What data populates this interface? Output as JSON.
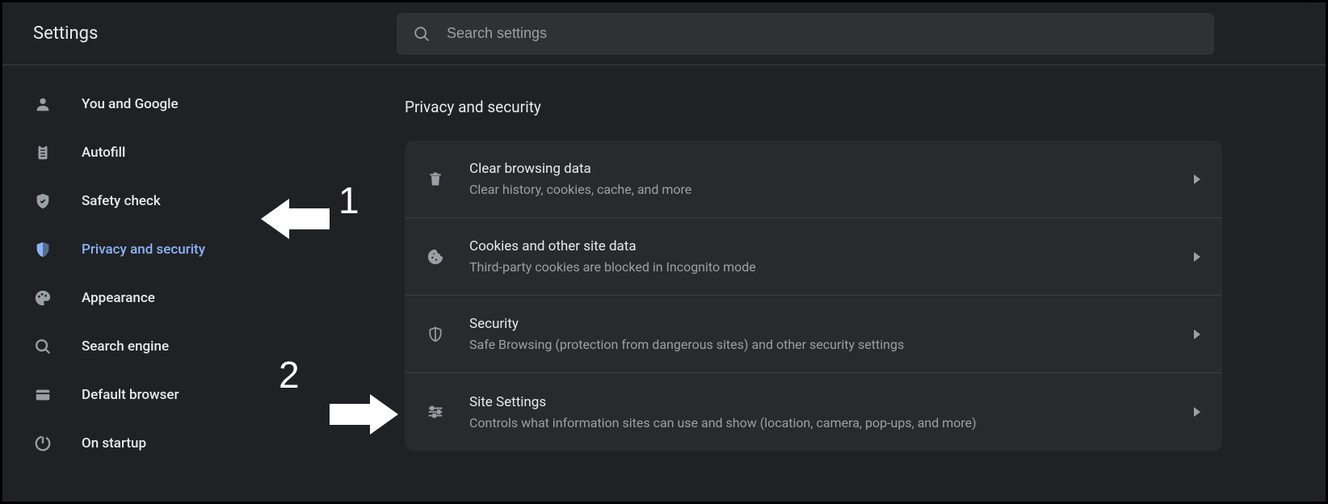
{
  "header": {
    "title": "Settings",
    "search_placeholder": "Search settings"
  },
  "sidebar": {
    "items": [
      {
        "id": "you-and-google",
        "label": "You and Google",
        "icon": "person-icon",
        "active": false
      },
      {
        "id": "autofill",
        "label": "Autofill",
        "icon": "clipboard-icon",
        "active": false
      },
      {
        "id": "safety-check",
        "label": "Safety check",
        "icon": "shield-check-icon",
        "active": false
      },
      {
        "id": "privacy-and-security",
        "label": "Privacy and security",
        "icon": "shield-icon",
        "active": true
      },
      {
        "id": "appearance",
        "label": "Appearance",
        "icon": "palette-icon",
        "active": false
      },
      {
        "id": "search-engine",
        "label": "Search engine",
        "icon": "search-icon",
        "active": false
      },
      {
        "id": "default-browser",
        "label": "Default browser",
        "icon": "browser-icon",
        "active": false
      },
      {
        "id": "on-startup",
        "label": "On startup",
        "icon": "power-icon",
        "active": false
      }
    ]
  },
  "main": {
    "section_title": "Privacy and security",
    "rows": [
      {
        "id": "clear-browsing-data",
        "icon": "trash-icon",
        "title": "Clear browsing data",
        "subtitle": "Clear history, cookies, cache, and more"
      },
      {
        "id": "cookies",
        "icon": "cookie-icon",
        "title": "Cookies and other site data",
        "subtitle": "Third-party cookies are blocked in Incognito mode"
      },
      {
        "id": "security",
        "icon": "shield-outline-icon",
        "title": "Security",
        "subtitle": "Safe Browsing (protection from dangerous sites) and other security settings"
      },
      {
        "id": "site-settings",
        "icon": "sliders-icon",
        "title": "Site Settings",
        "subtitle": "Controls what information sites can use and show (location, camera, pop-ups, and more)"
      }
    ]
  },
  "annotations": {
    "step1": "1",
    "step2": "2"
  }
}
